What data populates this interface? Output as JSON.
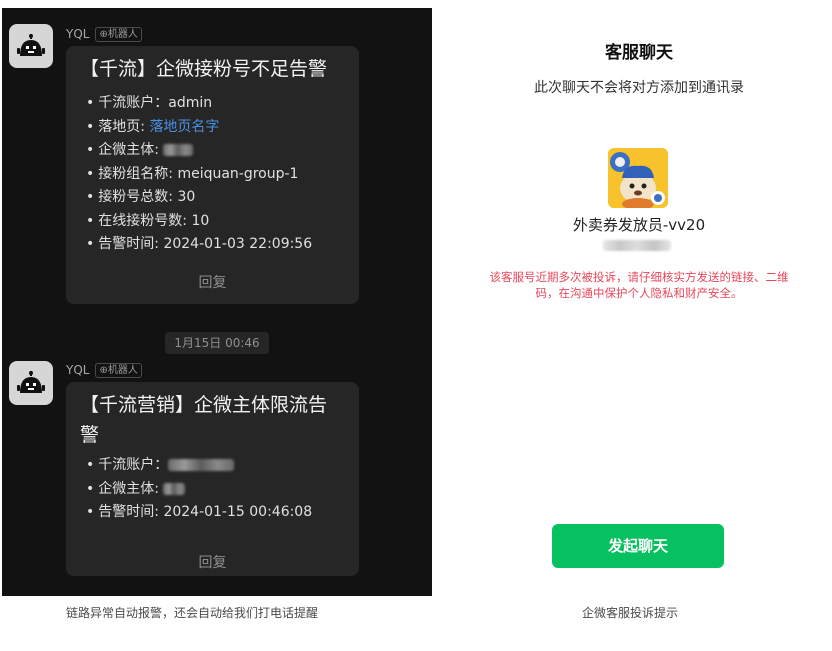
{
  "chat": {
    "messages": [
      {
        "sender": "YQL",
        "tag": "机器人",
        "title": "【千流】企微接粉号不足告警",
        "items": [
          {
            "label": "千流账户：",
            "value": "admin"
          },
          {
            "label": "落地页: ",
            "value": "落地页名字"
          },
          {
            "label": "企微主体: "
          },
          {
            "label": "接粉组名称: ",
            "value": "meiquan-group-1"
          },
          {
            "label": "接粉号总数: ",
            "value": "30"
          },
          {
            "label": "在线接粉号数: ",
            "value": "10"
          },
          {
            "label": "告警时间: ",
            "value": "2024-01-03 22:09:56"
          }
        ],
        "reply": "回复"
      },
      {
        "sender": "YQL",
        "tag": "机器人",
        "title_line1": "【千流营销】企微主体限流告",
        "title_line2": "警",
        "items": [
          {
            "label": "千流账户："
          },
          {
            "label": "企微主体: "
          },
          {
            "label": "告警时间: ",
            "value": "2024-01-15 00:46:08"
          }
        ],
        "reply": "回复"
      }
    ],
    "timestamp": "1月15日 00:46",
    "caption": "链路异常自动报警，还会自动给我们打电话提醒"
  },
  "service": {
    "title": "客服聊天",
    "subtitle": "此次聊天不会将对方添加到通讯录",
    "name": "外卖券发放员-vv20",
    "warning": "该客服号近期多次被投诉，请仔细核实方发送的链接、二维码，在沟通中保护个人隐私和财产安全。",
    "button": "发起聊天",
    "caption": "企微客服投诉提示",
    "avatar_icon": "cartoon-dog-avatar"
  },
  "colors": {
    "chat_bg": "#121212",
    "bubble_bg": "#262626",
    "link": "#4a90e2",
    "warning": "#e9475a",
    "button": "#07c160"
  }
}
